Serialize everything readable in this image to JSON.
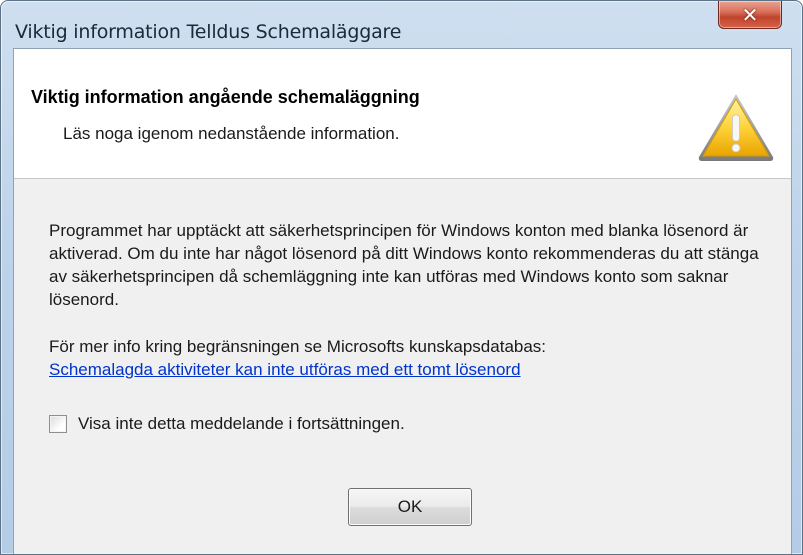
{
  "window": {
    "title": "Viktig information Telldus Schemaläggare",
    "close_glyph": "✕"
  },
  "header": {
    "title": "Viktig information angående schemaläggning",
    "subtitle": "Läs noga igenom nedanstående information.",
    "icon": "warning-icon"
  },
  "body": {
    "message": "Programmet har upptäckt att säkerhetsprincipen för Windows konton med blanka lösenord är aktiverad. Om du inte har något lösenord på ditt Windows konto rekommenderas du att stänga av säkerhetsprincipen då schemläggning inte kan utföras med Windows konto som saknar lösenord.",
    "info": "För mer info kring begränsningen se Microsofts kunskapsdatabas:",
    "link": "Schemalagda aktiviteter kan inte utföras med ett tomt lösenord"
  },
  "checkbox": {
    "label": "Visa inte detta meddelande i fortsättningen.",
    "checked": false
  },
  "buttons": {
    "ok": "OK"
  },
  "colors": {
    "link": "#0033cc",
    "close_button": "#c0442c",
    "title_bar": "#bdd3ea"
  }
}
